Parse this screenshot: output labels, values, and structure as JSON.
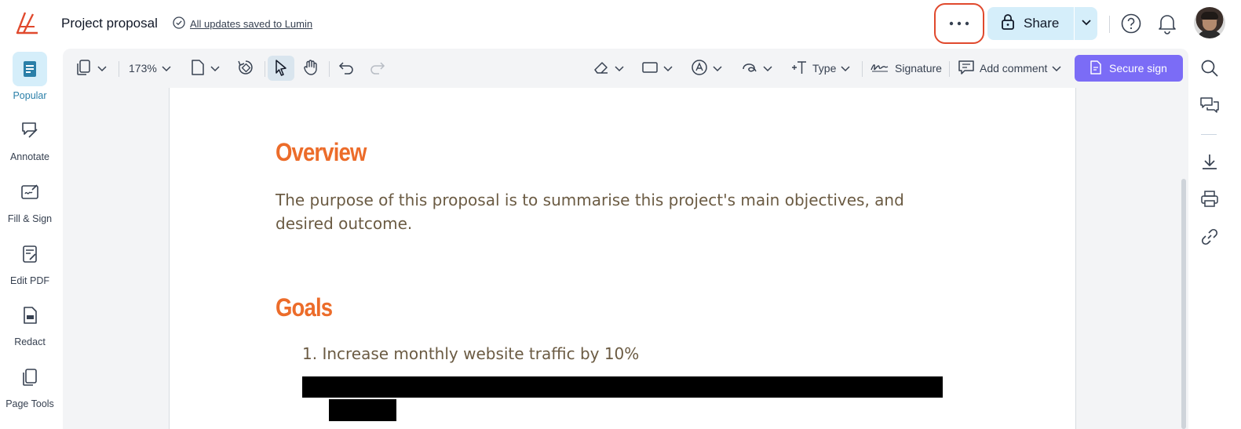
{
  "header": {
    "title": "Project proposal",
    "saved_status": "All updates saved to Lumin",
    "share_label": "Share"
  },
  "left_sidebar": {
    "items": [
      {
        "label": "Popular",
        "icon": "popular-icon",
        "active": true
      },
      {
        "label": "Annotate",
        "icon": "annotate-icon",
        "active": false
      },
      {
        "label": "Fill & Sign",
        "icon": "fill-sign-icon",
        "active": false
      },
      {
        "label": "Edit PDF",
        "icon": "edit-pdf-icon",
        "active": false
      },
      {
        "label": "Redact",
        "icon": "redact-icon",
        "active": false
      },
      {
        "label": "Page Tools",
        "icon": "page-tools-icon",
        "active": false
      }
    ]
  },
  "toolbar": {
    "zoom": "173%",
    "type_label": "Type",
    "signature_label": "Signature",
    "add_comment_label": "Add comment",
    "secure_sign_label": "Secure sign"
  },
  "document": {
    "heading_overview": "Overview",
    "overview_text": "The purpose of this proposal is to summarise this project's main objectives, and desired outcome.",
    "heading_goals": "Goals",
    "goal_1": "1. Increase monthly website traffic by 10%"
  },
  "colors": {
    "accent_blue_bg": "#d5eefa",
    "heading_orange": "#ec6c2a",
    "secure_sign_purple": "#7b6cf6",
    "highlight_ring": "#e0492d"
  }
}
